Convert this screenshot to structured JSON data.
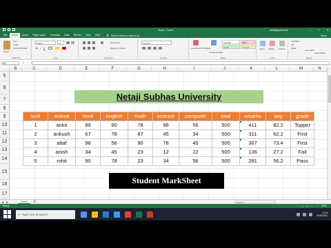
{
  "window": {
    "title": "Book1 - Excel",
    "user": "ankit@gmail.com"
  },
  "tabs": [
    "File",
    "Home",
    "Insert",
    "Page Layout",
    "Formulas",
    "Data",
    "Review",
    "View",
    "Help"
  ],
  "active_tab": "Home",
  "tellme": "Tell me what you want to do",
  "tab_right": {
    "share": "Share"
  },
  "ribbon": {
    "clipboard": {
      "label": "Clipboard",
      "paste": "Paste",
      "cut": "Cut",
      "copy": "Copy",
      "format_painter": "Format Painter"
    },
    "font": {
      "label": "Font",
      "name": "Calibri",
      "size": "11",
      "bold": "B",
      "italic": "I",
      "underline": "U"
    },
    "alignment": {
      "label": "Alignment",
      "wrap": "Wrap Text",
      "merge": "Merge & Center"
    },
    "number": {
      "label": "Number",
      "format": "General"
    },
    "styles": {
      "label": "Styles",
      "conditional": "Conditional Formatting",
      "format_table": "Format as Table",
      "normal": "Normal",
      "bad": "Bad",
      "good": "Good",
      "neutral": "Neutral"
    },
    "cells": {
      "label": "Cells",
      "insert": "Insert",
      "delete": "Delete",
      "format": "Format"
    },
    "editing": {
      "label": "Editing",
      "autosum": "AutoSum",
      "fill": "Fill",
      "clear": "Clear",
      "sort": "Sort & Filter",
      "find": "Find & Select"
    }
  },
  "namebox": "O4",
  "columns": [
    "B",
    "C",
    "D",
    "E",
    "F",
    "G",
    "H",
    "I",
    "J",
    "K",
    "L",
    "M",
    "N"
  ],
  "rows": [
    "5",
    "6",
    "7",
    "8",
    "9",
    "10",
    "11",
    "12",
    "13",
    "14",
    "15",
    "16",
    "17"
  ],
  "university": "Netaji Subhas University",
  "table": {
    "headers": [
      "sroll",
      "sname",
      "hindi",
      "english",
      "math",
      "science",
      "computer",
      "total",
      "omarks",
      "avg",
      "grade"
    ],
    "rows": [
      [
        "1",
        "ankit",
        "89",
        "90",
        "78",
        "98",
        "56",
        "500",
        "411",
        "82.2",
        "Topper"
      ],
      [
        "2",
        "ankush",
        "67",
        "78",
        "87",
        "45",
        "34",
        "500",
        "311",
        "62.2",
        "First"
      ],
      [
        "3",
        "altaf",
        "98",
        "56",
        "90",
        "78",
        "45",
        "500",
        "367",
        "73.4",
        "First"
      ],
      [
        "4",
        "anish",
        "34",
        "45",
        "23",
        "12",
        "22",
        "500",
        "136",
        "27.2",
        "Fail"
      ],
      [
        "5",
        "rohit",
        "90",
        "78",
        "23",
        "34",
        "56",
        "500",
        "281",
        "56.2",
        "Pass"
      ]
    ]
  },
  "caption": "Student MarkSheet",
  "sheet_tab": "Sheet1",
  "hscroll": "Sheet1 ▸",
  "status": {
    "left": "Ready",
    "zoom": "100%"
  },
  "taskbar": {
    "search": "Type here to search",
    "time": "17:34",
    "date": "24-08-2021"
  },
  "colors": {
    "excel_green": "#217346",
    "header_orange": "#ed7d31",
    "title_green": "#a9d18e",
    "taskbar": "#1c2230"
  }
}
